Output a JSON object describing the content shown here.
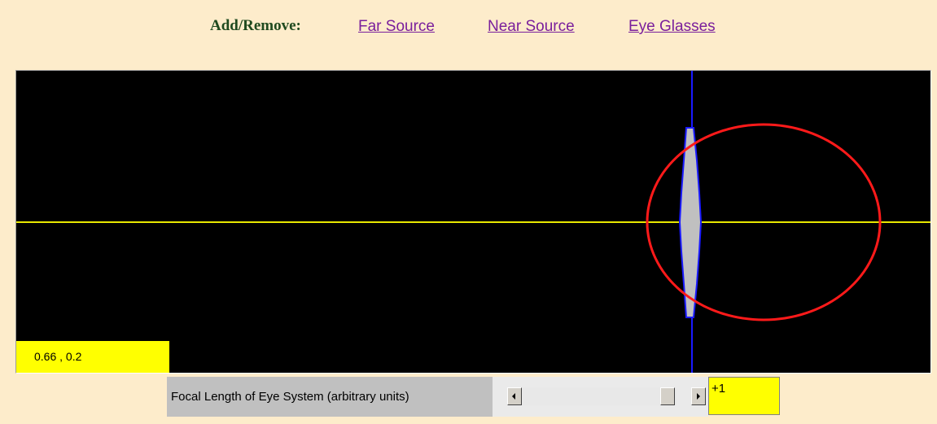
{
  "header": {
    "label": "Add/Remove:",
    "links": [
      {
        "label": "Far Source"
      },
      {
        "label": "Near Source"
      },
      {
        "label": "Eye Glasses"
      }
    ]
  },
  "simulation": {
    "background_color": "#000000",
    "optical_axis_color": "#e8e800",
    "lens_color": "#c0c0c0",
    "lens_outline_color": "#1a1aff",
    "eye_color": "#ff1a1a",
    "coordinate_readout": "0.66 , 0.2"
  },
  "control": {
    "label": "Focal Length of Eye System (arbitrary units)",
    "slider_level_fraction": 0.99,
    "value": "+1",
    "value_color": "#ffff00"
  }
}
